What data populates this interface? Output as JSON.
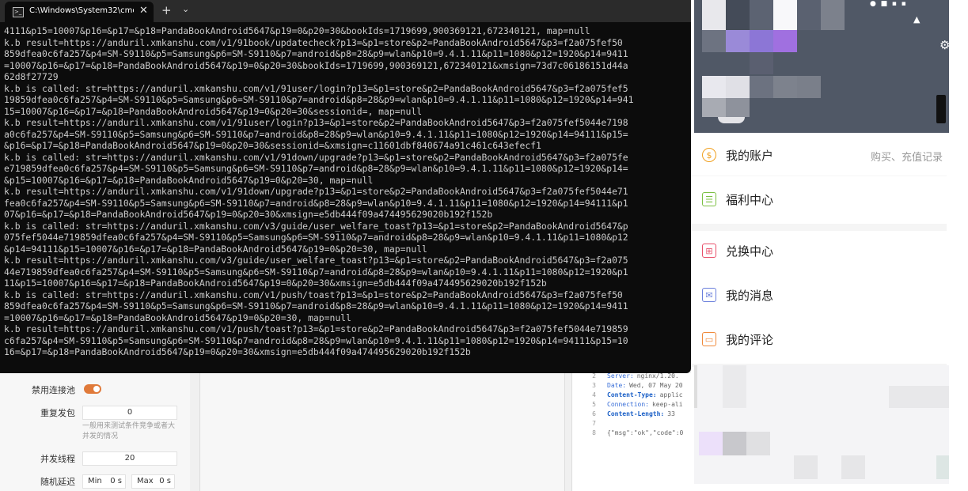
{
  "terminal": {
    "tab_title": "C:\\Windows\\System32\\cmd.ex",
    "new_tab": "+",
    "close": "✕",
    "dropdown": "⌄",
    "lines": [
      "4111&p15=10007&p16=&p17=&p18=PandaBookAndroid5647&p19=0&p20=30&bookIds=1719699,900369121,672340121, map=null",
      "k.b result=https://anduril.xmkanshu.com/v1/91book/updatecheck?p13=&p1=store&p2=PandaBookAndroid5647&p3=f2a075fef50",
      "859dfea0c6fa257&p4=SM-S9110&p5=Samsung&p6=SM-S9110&p7=android&p8=28&p9=wlan&p10=9.4.1.11&p11=1080&p12=1920&p14=9411",
      "=10007&p16=&p17=&p18=PandaBookAndroid5647&p19=0&p20=30&bookIds=1719699,900369121,672340121&xmsign=73d7c06186151d44a",
      "62d8f27729",
      "k.b is called: str=https://anduril.xmkanshu.com/v1/91user/login?p13=&p1=store&p2=PandaBookAndroid5647&p3=f2a075fef5",
      "19859dfea0c6fa257&p4=SM-S9110&p5=Samsung&p6=SM-S9110&p7=android&p8=28&p9=wlan&p10=9.4.1.11&p11=1080&p12=1920&p14=941",
      "15=10007&p16=&p17=&p18=PandaBookAndroid5647&p19=0&p20=30&sessionid=, map=null",
      "k.b result=https://anduril.xmkanshu.com/v1/91user/login?p13=&p1=store&p2=PandaBookAndroid5647&p3=f2a075fef5044e7198",
      "a0c6fa257&p4=SM-S9110&p5=Samsung&p6=SM-S9110&p7=android&p8=28&p9=wlan&p10=9.4.1.11&p11=1080&p12=1920&p14=94111&p15=",
      "&p16=&p17=&p18=PandaBookAndroid5647&p19=0&p20=30&sessionid=&xmsign=c11601dbf840674a91c461c643efecf1",
      "k.b is called: str=https://anduril.xmkanshu.com/v1/91down/upgrade?p13=&p1=store&p2=PandaBookAndroid5647&p3=f2a075fe",
      "e719859dfea0c6fa257&p4=SM-S9110&p5=Samsung&p6=SM-S9110&p7=android&p8=28&p9=wlan&p10=9.4.1.11&p11=1080&p12=1920&p14=",
      "&p15=10007&p16=&p17=&p18=PandaBookAndroid5647&p19=0&p20=30, map=null",
      "k.b result=https://anduril.xmkanshu.com/v1/91down/upgrade?p13=&p1=store&p2=PandaBookAndroid5647&p3=f2a075fef5044e71",
      "fea0c6fa257&p4=SM-S9110&p5=Samsung&p6=SM-S9110&p7=android&p8=28&p9=wlan&p10=9.4.1.11&p11=1080&p12=1920&p14=94111&p1",
      "07&p16=&p17=&p18=PandaBookAndroid5647&p19=0&p20=30&xmsign=e5db444f09a474495629020b192f152b",
      "k.b is called: str=https://anduril.xmkanshu.com/v3/guide/user_welfare_toast?p13=&p1=store&p2=PandaBookAndroid5647&p",
      "075fef5044e719859dfea0c6fa257&p4=SM-S9110&p5=Samsung&p6=SM-S9110&p7=android&p8=28&p9=wlan&p10=9.4.1.11&p11=1080&p12",
      "&p14=94111&p15=10007&p16=&p17=&p18=PandaBookAndroid5647&p19=0&p20=30, map=null",
      "k.b result=https://anduril.xmkanshu.com/v3/guide/user_welfare_toast?p13=&p1=store&p2=PandaBookAndroid5647&p3=f2a075",
      "44e719859dfea0c6fa257&p4=SM-S9110&p5=Samsung&p6=SM-S9110&p7=android&p8=28&p9=wlan&p10=9.4.1.11&p11=1080&p12=1920&p1",
      "11&p15=10007&p16=&p17=&p18=PandaBookAndroid5647&p19=0&p20=30&xmsign=e5db444f09a474495629020b192f152b",
      "k.b is called: str=https://anduril.xmkanshu.com/v1/push/toast?p13=&p1=store&p2=PandaBookAndroid5647&p3=f2a075fef50",
      "859dfea0c6fa257&p4=SM-S9110&p5=Samsung&p6=SM-S9110&p7=android&p8=28&p9=wlan&p10=9.4.1.11&p11=1080&p12=1920&p14=9411",
      "=10007&p16=&p17=&p18=PandaBookAndroid5647&p19=0&p20=30, map=null",
      "k.b result=https://anduril.xmkanshu.com/v1/push/toast?p13=&p1=store&p2=PandaBookAndroid5647&p3=f2a075fef5044e719859",
      "c6fa257&p4=SM-S9110&p5=Samsung&p6=SM-S9110&p7=android&p8=28&p9=wlan&p10=9.4.1.11&p11=1080&p12=1920&p14=94111&p15=10",
      "16=&p17=&p18=PandaBookAndroid5647&p19=0&p20=30&xmsign=e5db444f09a474495629020b192f152b"
    ]
  },
  "settings": {
    "disable_pool_label": "禁用连接池",
    "repeat_label": "重复发包",
    "repeat_value": "0",
    "repeat_hint": "一般用来测试条件竞争或者大并发的情况",
    "threads_label": "并发线程",
    "threads_value": "20",
    "delay_label": "随机延迟",
    "delay_min_label": "Min",
    "delay_min_value": "0 s",
    "delay_max_label": "Max",
    "delay_max_value": "0 s"
  },
  "response": {
    "lines": [
      {
        "n": "2",
        "key": "Server:",
        "val": "nginx/1.20.",
        "bold": false
      },
      {
        "n": "3",
        "key": "Date:",
        "val": "Wed, 07 May 20",
        "bold": false
      },
      {
        "n": "4",
        "key": "Content-Type:",
        "val": "applic",
        "bold": true
      },
      {
        "n": "5",
        "key": "Connection:",
        "val": "keep-ali",
        "bold": false
      },
      {
        "n": "6",
        "key": "Content-Length:",
        "val": "33",
        "bold": true
      },
      {
        "n": "7",
        "key": "",
        "val": "",
        "bold": false
      },
      {
        "n": "8",
        "key": "{\"msg\":\"ok\",\"code\":0",
        "val": "",
        "bold": false
      }
    ]
  },
  "phone": {
    "menu": [
      {
        "label": "我的账户",
        "right": "购买、充值记录",
        "icon": "coin-icon",
        "color": "#f0a020"
      },
      {
        "label": "福利中心",
        "right": "",
        "icon": "list-icon",
        "color": "#7cc043"
      },
      {
        "label": "兑换中心",
        "right": "",
        "icon": "gift-icon",
        "color": "#e8506a"
      },
      {
        "label": "我的消息",
        "right": "",
        "icon": "mail-icon",
        "color": "#6a7fdc"
      },
      {
        "label": "我的评论",
        "right": "",
        "icon": "comment-icon",
        "color": "#f08a3a"
      }
    ]
  },
  "colors": {
    "terminal_bg": "#0c0c0c",
    "terminal_text": "#cccccc",
    "accent_orange": "#e07a3a"
  }
}
